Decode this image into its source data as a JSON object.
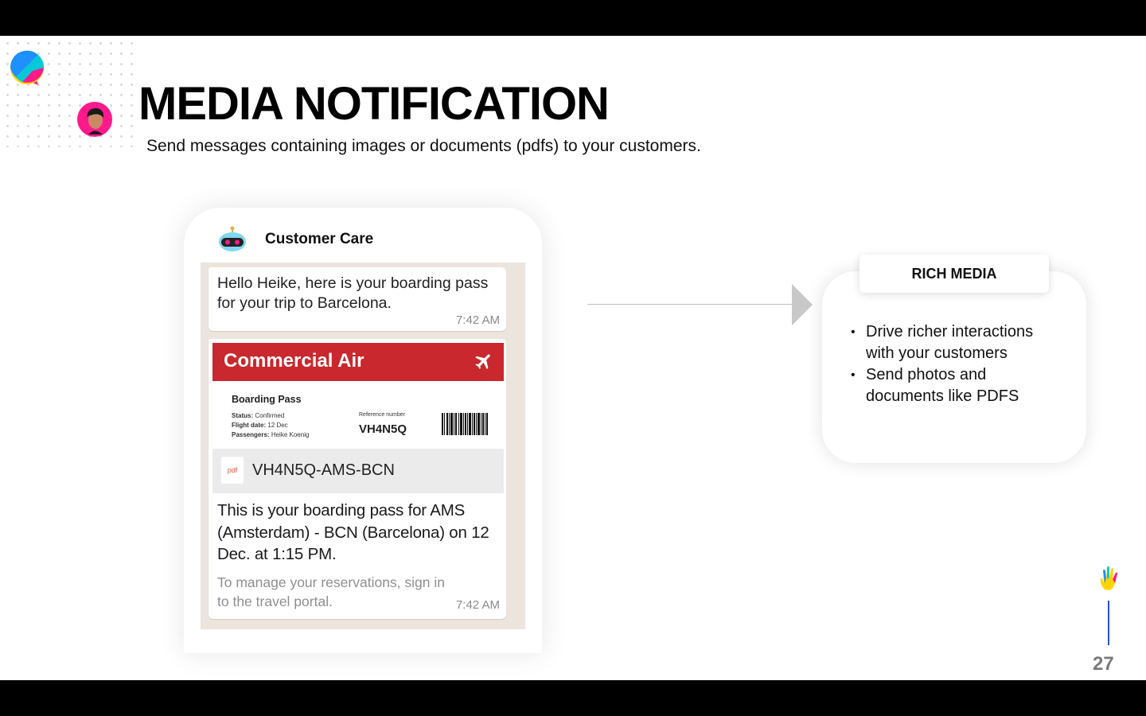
{
  "slide": {
    "title": "MEDIA NOTIFICATION",
    "subtitle": "Send messages containing images or documents (pdfs) to your customers.",
    "page_number": "27"
  },
  "chat": {
    "name": "Customer Care",
    "message1": {
      "text": "Hello Heike, here is your boarding pass for your trip to Barcelona.",
      "time": "7:42 AM"
    },
    "boarding_pass": {
      "airline": "Commercial Air",
      "heading": "Boarding Pass",
      "status_label": "Status:",
      "status_value": "Confirmed",
      "flight_date_label": "Flight date:",
      "flight_date_value": "12 Dec",
      "passengers_label": "Passengers:",
      "passengers_value": "Heike Koenig",
      "reference_label": "Reference number",
      "reference_value": "VH4N5Q"
    },
    "document": {
      "icon_label": "pdf",
      "name": "VH4N5Q-AMS-BCN"
    },
    "message2": {
      "text": "This is your boarding pass for AMS (Amsterdam) - BCN (Barcelona) on 12 Dec. at 1:15 PM.",
      "note": "To manage your reservations, sign in to the travel portal.",
      "time": "7:42 AM"
    }
  },
  "rich_media": {
    "tab_label": "RICH MEDIA",
    "bullets": [
      "Drive richer interactions with your customers",
      "Send photos and documents like PDFS"
    ]
  },
  "colors": {
    "airline_red": "#c8282e",
    "chat_background": "#ece5dd",
    "accent_blue": "#2a4fcf",
    "avatar_pink": "#ff1a8c"
  },
  "icons": {
    "logo": "chat-bubble-logo-icon",
    "avatar": "user-avatar-icon",
    "bot": "bot-icon",
    "plane": "plane-icon",
    "pdf": "pdf-icon",
    "hand": "hand-icon"
  }
}
